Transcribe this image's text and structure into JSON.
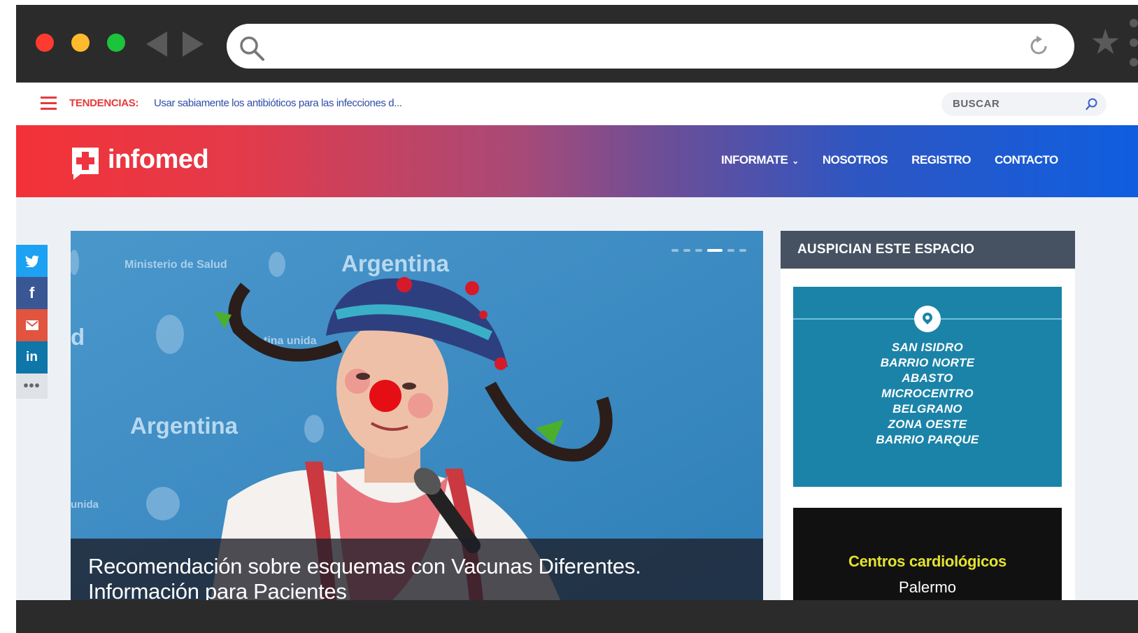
{
  "browser": {
    "url": "",
    "icons": [
      "search-icon",
      "reload-icon",
      "star-icon",
      "kebab-menu-icon"
    ]
  },
  "trending": {
    "label": "TENDENCIAS:",
    "text": "Usar sabiamente los antibióticos para las infecciones d..."
  },
  "search": {
    "label": "BUSCAR"
  },
  "header": {
    "logo": "infomed",
    "nav": [
      {
        "label": "INFORMATE"
      },
      {
        "label": "NOSOTROS"
      },
      {
        "label": "REGISTRO"
      },
      {
        "label": "CONTACTO"
      }
    ],
    "colors": {
      "gradient_start": "#f33238",
      "gradient_end": "#0f5ee0"
    }
  },
  "social": [
    "twitter-icon",
    "facebook-icon",
    "email-icon",
    "linkedin-icon",
    "more-icon"
  ],
  "hero": {
    "backdrop_texts": [
      "Argentina",
      "Ministerio de Salud",
      "Argentina",
      "d",
      "unida",
      "tina unida"
    ],
    "caption": "Recomendación sobre esquemas con Vacunas Diferentes. Información para Pacientes",
    "carousel_active": 4,
    "carousel_count": 6
  },
  "sidebar": {
    "title": "AUSPICIAN ESTE ESPACIO",
    "ad1": {
      "locations": [
        "SAN ISIDRO",
        "BARRIO NORTE",
        "ABASTO",
        "MICROCENTRO",
        "BELGRANO",
        "ZONA OESTE",
        "BARRIO PARQUE"
      ],
      "color": "#1b83a8"
    },
    "ad2": {
      "title": "Centros cardiológicos",
      "subtitle": "Palermo"
    }
  }
}
